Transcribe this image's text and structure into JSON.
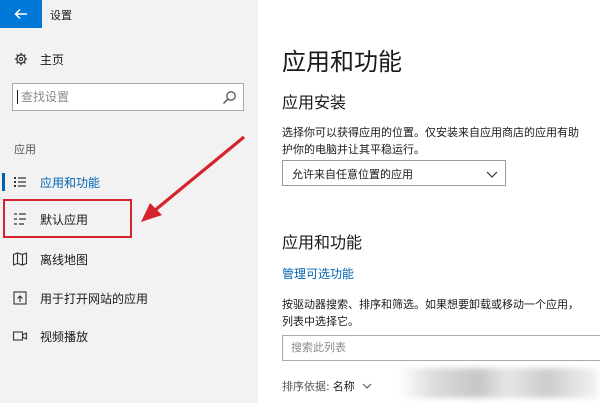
{
  "window": {
    "title": "设置"
  },
  "sidebar": {
    "home_label": "主页",
    "search_placeholder": "查找设置",
    "section_label": "应用",
    "items": [
      {
        "label": "应用和功能",
        "icon": "apps-list-icon",
        "selected": true
      },
      {
        "label": "默认应用",
        "icon": "default-apps-icon",
        "selected": false
      },
      {
        "label": "离线地图",
        "icon": "offline-map-icon",
        "selected": false
      },
      {
        "label": "用于打开网站的应用",
        "icon": "open-website-icon",
        "selected": false
      },
      {
        "label": "视频播放",
        "icon": "video-playback-icon",
        "selected": false
      }
    ]
  },
  "main": {
    "page_title": "应用和功能",
    "install_heading": "应用安装",
    "install_desc_line1": "选择你可以获得应用的位置。仅安装来自应用商店的应用有助",
    "install_desc_line2": "护你的电脑并让其平稳运行。",
    "install_dropdown_value": "允许来自任意位置的应用",
    "features_heading": "应用和功能",
    "manage_optional_link": "管理可选功能",
    "features_desc_line1": "按驱动器搜索、排序和筛选。如果想要卸载或移动一个应用，",
    "features_desc_line2": "列表中选择它。",
    "list_search_placeholder": "搜索此列表",
    "sort_label": "排序依据:",
    "sort_value": "名称"
  },
  "colors": {
    "accent": "#0078d7",
    "link": "#0063b1",
    "annotation_red": "#d5242b",
    "sidebar_bg": "#f2f2f2"
  }
}
